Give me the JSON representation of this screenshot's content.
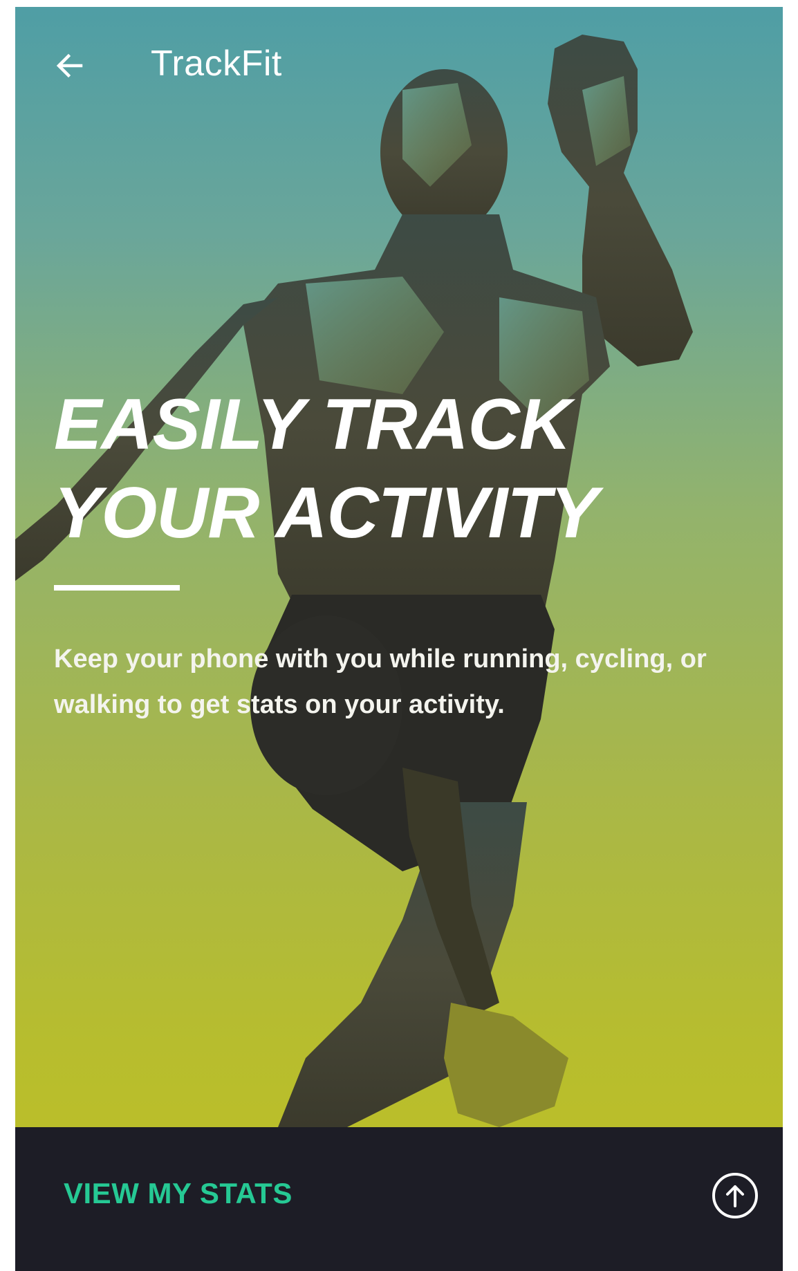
{
  "app_bar": {
    "title": "TrackFit",
    "back_icon": "arrow-left-icon"
  },
  "hero": {
    "headline_line1": "EASILY TRACK",
    "headline_line2": "YOUR ACTIVITY",
    "description": "Keep your phone with you while running, cycling, or walking to get stats on your activity."
  },
  "bottom_bar": {
    "cta_label": "VIEW MY STATS",
    "cta_color": "#26c994",
    "up_icon": "arrow-up-circle-icon",
    "background": "#1d1d26"
  },
  "colors": {
    "gradient_top": "#4f9ea5",
    "gradient_bottom": "#c0c024",
    "text": "#ffffff"
  }
}
